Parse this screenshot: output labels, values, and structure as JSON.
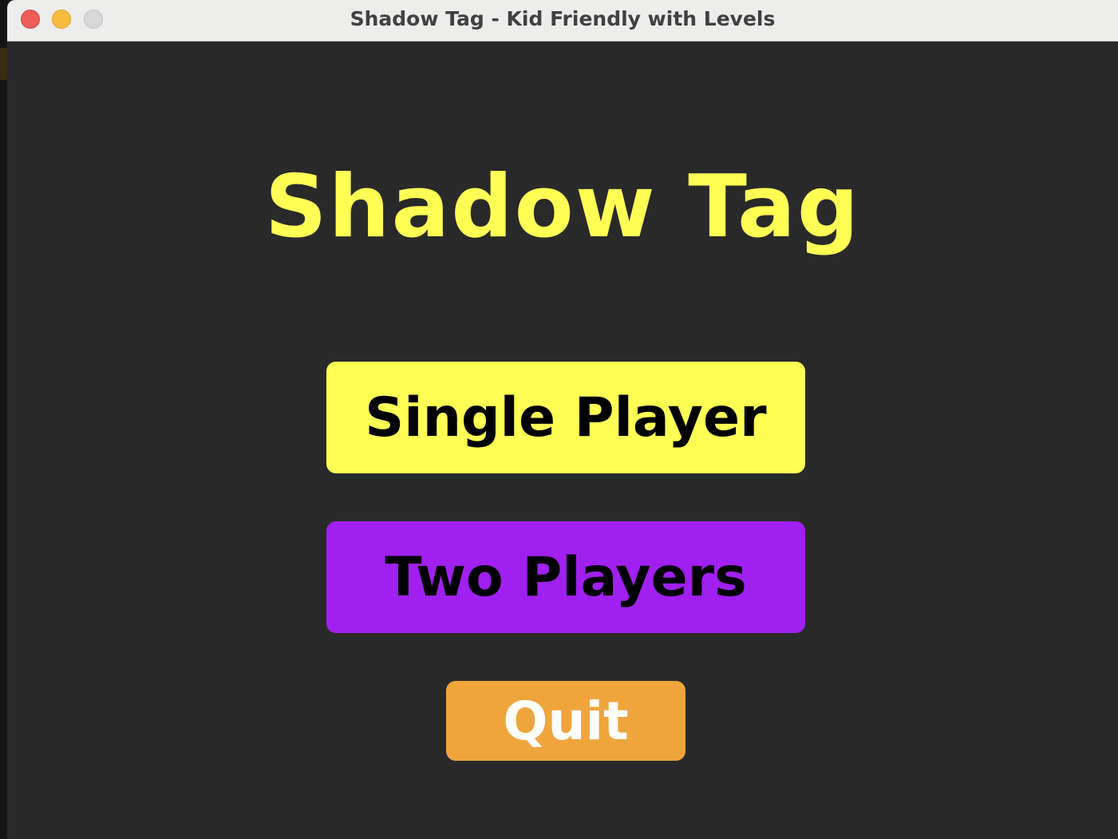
{
  "window": {
    "title": "Shadow Tag - Kid Friendly with Levels",
    "controls": [
      "close",
      "minimize",
      "zoom"
    ]
  },
  "game": {
    "title": "Shadow Tag",
    "title_color": "#ffff55"
  },
  "menu": {
    "single_player": {
      "label": "Single Player",
      "bg": "#ffff55",
      "fg": "#000000"
    },
    "two_players": {
      "label": "Two Players",
      "bg": "#a020f0",
      "fg": "#000000"
    },
    "quit": {
      "label": "Quit",
      "bg": "#f0a53c",
      "fg": "#ffffff"
    }
  },
  "colors": {
    "background": "#292929"
  }
}
